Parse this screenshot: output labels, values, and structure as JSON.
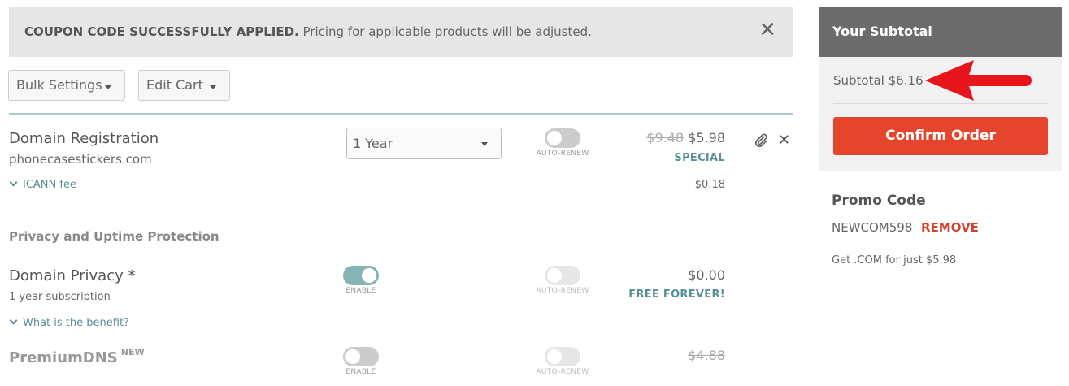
{
  "banner": {
    "bold_text": "COUPON CODE SUCCESSFULLY APPLIED.",
    "text": " Pricing for applicable products will be adjusted.",
    "close_icon": "close-icon"
  },
  "toolbar": {
    "bulk_settings_label": "Bulk Settings",
    "edit_cart_label": "Edit Cart"
  },
  "domain_registration": {
    "title": "Domain Registration",
    "domain": "phonecasestickers.com",
    "period_selected": "1 Year",
    "auto_renew_label": "AUTO-RENEW",
    "auto_renew_on": false,
    "old_price": "$9.48",
    "price": "$5.98",
    "badge": "SPECIAL",
    "icann_label": "ICANN fee",
    "icann_price": "$0.18",
    "attach_icon": "paperclip-icon",
    "remove_icon": "close-icon"
  },
  "privacy_section": {
    "title": "Privacy and Uptime Protection"
  },
  "domain_privacy": {
    "title": "Domain Privacy *",
    "subtitle": "1 year subscription",
    "enable_label": "ENABLE",
    "enabled": true,
    "auto_renew_label": "AUTO-RENEW",
    "price": "$0.00",
    "badge": "FREE FOREVER!",
    "benefit_link": "What is the benefit?"
  },
  "premium_dns": {
    "title": "PremiumDNS",
    "superscript": "NEW",
    "enable_label": "ENABLE",
    "enabled": false,
    "auto_renew_label": "AUTO-RENEW",
    "price": "$4.88"
  },
  "subtotal_panel": {
    "title": "Your Subtotal",
    "subtotal_line": "Subtotal $6.16",
    "confirm_label": "Confirm Order"
  },
  "promo": {
    "title": "Promo Code",
    "code": "NEWCOM598",
    "remove_label": "REMOVE",
    "description": "Get .COM for just $5.98"
  },
  "colors": {
    "accent_teal": "#5b8f97",
    "confirm_red": "#e4452c",
    "remove_red": "#d0442f",
    "annotation_arrow": "#e8141c"
  }
}
